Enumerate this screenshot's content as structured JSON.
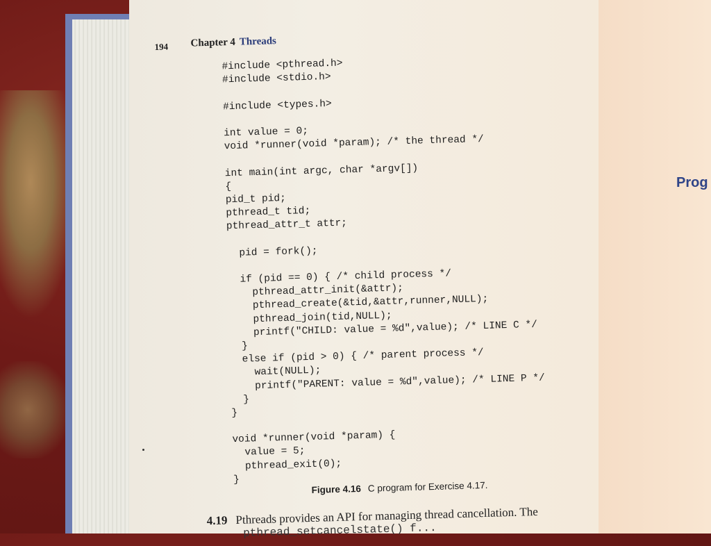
{
  "page": {
    "page_number": "194",
    "chapter_label": "Chapter 4",
    "chapter_title": "Threads"
  },
  "code_lines": [
    "#include <pthread.h>",
    "#include <stdio.h>",
    "",
    "#include <types.h>",
    "",
    "int value = 0;",
    "void *runner(void *param); /* the thread */",
    "",
    "int main(int argc, char *argv[])",
    "{",
    "pid_t pid;",
    "pthread_t tid;",
    "pthread_attr_t attr;",
    "",
    "  pid = fork();",
    "",
    "  if (pid == 0) { /* child process */",
    "    pthread_attr_init(&attr);",
    "    pthread_create(&tid,&attr,runner,NULL);",
    "    pthread_join(tid,NULL);",
    "    printf(\"CHILD: value = %d\",value); /* LINE C */",
    "  }",
    "  else if (pid > 0) { /* parent process */",
    "    wait(NULL);",
    "    printf(\"PARENT: value = %d\",value); /* LINE P */",
    "  }",
    "}",
    "",
    "void *runner(void *param) {",
    "  value = 5;",
    "  pthread_exit(0);",
    "}"
  ],
  "caption": {
    "label": "Figure 4.16",
    "text": "C program for Exercise 4.17."
  },
  "exercise": {
    "number": "4.19",
    "text": "Pthreads provides an API for managing thread cancellation. The",
    "continuation": "pthread_setcancelstate() f..."
  },
  "right_page": {
    "heading_fragment": "Prog"
  },
  "colors": {
    "chapter_title": "#2c3d7a",
    "right_heading": "#2f4488",
    "book_cover": "#6f7fb4",
    "rug": "#6e1a17"
  }
}
